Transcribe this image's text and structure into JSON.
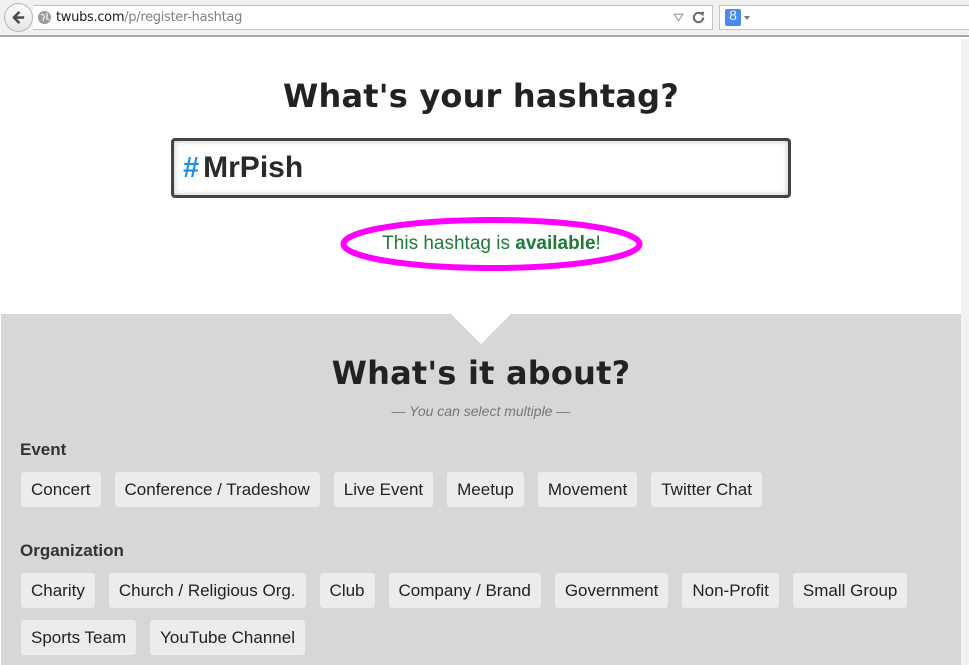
{
  "browser": {
    "url_host": "twubs.com",
    "url_path": "/p/register-hashtag",
    "search_engine_icon": "google-g-icon",
    "search_engine_glyph": "8"
  },
  "hero": {
    "title": "What's your hashtag?",
    "hash_symbol": "#",
    "hashtag_value": "MrPish",
    "availability_prefix": "This hashtag is ",
    "availability_status": "available",
    "availability_suffix": "!",
    "status_color": "#1f7a3a",
    "highlight_color": "#ff00ff"
  },
  "about": {
    "title": "What's it about?",
    "subtitle": "— You can select multiple —",
    "groups": [
      {
        "label": "Event",
        "options": [
          "Concert",
          "Conference / Tradeshow",
          "Live Event",
          "Meetup",
          "Movement",
          "Twitter Chat"
        ]
      },
      {
        "label": "Organization",
        "options": [
          "Charity",
          "Church / Religious Org.",
          "Club",
          "Company / Brand",
          "Government",
          "Non-Profit",
          "Small Group",
          "Sports Team",
          "YouTube Channel"
        ]
      }
    ]
  }
}
